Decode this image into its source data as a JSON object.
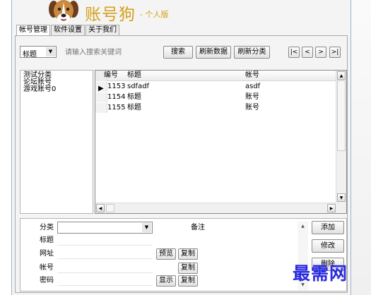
{
  "app": {
    "title": "账号狗",
    "edition": "- 个人版"
  },
  "tabs": [
    {
      "label": "帐号管理",
      "active": true
    },
    {
      "label": "软件设置",
      "active": false
    },
    {
      "label": "关于我们",
      "active": false
    }
  ],
  "toolbar": {
    "search_field_selected": "标题",
    "search_placeholder": "请输入搜索关键词",
    "search_button": "搜索",
    "refresh_data_button": "刷新数据",
    "refresh_category_button": "刷新分类",
    "nav": [
      "|<",
      "<",
      ">",
      ">|"
    ]
  },
  "categories": [
    "测试分类",
    "论坛账号",
    "游戏账号0"
  ],
  "grid": {
    "columns": [
      "编号",
      "标题",
      "帐号"
    ],
    "rows": [
      {
        "id": "1153",
        "title": "sdfadf",
        "account": "asdf",
        "selected": true
      },
      {
        "id": "1154",
        "title": "标题",
        "account": "账号",
        "selected": false
      },
      {
        "id": "1155",
        "title": "标题",
        "account": "账号",
        "selected": false
      }
    ]
  },
  "detail": {
    "category_label": "分类",
    "category_value": "",
    "notes_label": "备注",
    "title_label": "标题",
    "url_label": "网址",
    "preview_button": "预览",
    "copy_url_button": "复制",
    "account_label": "帐号",
    "copy_account_button": "复制",
    "password_label": "密码",
    "show_button": "显示",
    "copy_password_button": "复制",
    "add_button": "添加",
    "edit_button": "修改",
    "delete_button": "删除"
  },
  "watermark": "最需网",
  "colors": {
    "brand": "#d4a017",
    "watermark": "#2b2be0"
  }
}
